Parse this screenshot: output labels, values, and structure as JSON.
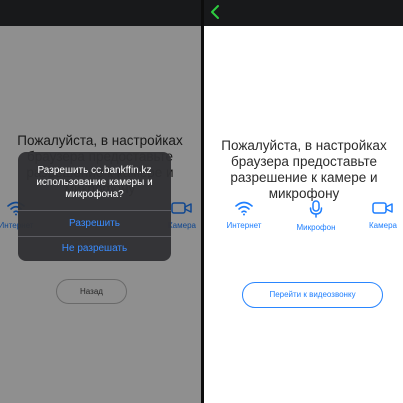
{
  "left_screen": {
    "message": "Пожалуйста, в настройках браузера предоставьте разрешение к камере и микрофону",
    "features": [
      {
        "label": "Интернет",
        "icon": "wifi-icon"
      },
      {
        "label": "Камера",
        "icon": "camera-icon"
      }
    ],
    "back_button": "Назад",
    "dialog": {
      "title": "Разрешить cc.bankffin.kz использование камеры и микрофона?",
      "allow_label": "Разрешить",
      "deny_label": "Не разрешать"
    }
  },
  "right_screen": {
    "message": "Пожалуйста, в настройках браузера предоставьте разрешение к камере и микрофону",
    "features": [
      {
        "label": "Интернет",
        "icon": "wifi-icon"
      },
      {
        "label": "Микрофон",
        "icon": "microphone-icon"
      },
      {
        "label": "Камера",
        "icon": "camera-icon"
      }
    ],
    "video_button": "Перейти к видеозвонку",
    "back_icon": "chevron-left-icon"
  },
  "colors": {
    "accent": "#1e7fff",
    "back_arrow": "#2ecc40",
    "topbar": "#18191b",
    "dialog_bg": "#303033"
  }
}
